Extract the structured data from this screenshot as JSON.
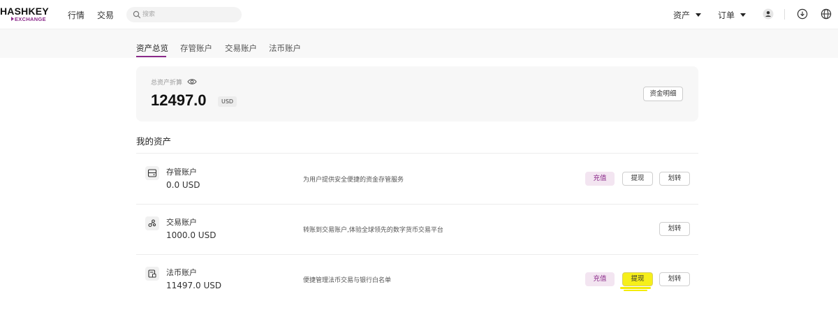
{
  "header": {
    "logo_main": "HASHKEY",
    "logo_sub": "EXCHANGE",
    "nav": [
      "行情",
      "交易"
    ],
    "search_placeholder": "搜索",
    "menus": [
      "资产",
      "订单"
    ]
  },
  "tabs": [
    "资产总览",
    "存管账户",
    "交易账户",
    "法币账户"
  ],
  "summary": {
    "label": "总资产折算",
    "value": "12497.0",
    "unit": "USD",
    "detail_button": "资金明细"
  },
  "section_title": "我的资产",
  "accounts": [
    {
      "icon": "vault-icon",
      "name": "存管账户",
      "balance": "0.0 USD",
      "description": "为用户提供安全便捷的资金存管服务",
      "buttons": {
        "deposit": "充值",
        "withdraw": "提现",
        "transfer": "划转"
      }
    },
    {
      "icon": "nodes-icon",
      "name": "交易账户",
      "balance": "1000.0 USD",
      "description": "转账到交易账户,体验全球领先的数字货币交易平台",
      "buttons": {
        "transfer": "划转"
      }
    },
    {
      "icon": "bank-card-icon",
      "name": "法币账户",
      "balance": "11497.0 USD",
      "description": "便捷管理法币交易与银行白名单",
      "buttons": {
        "deposit": "充值",
        "withdraw": "提现",
        "transfer": "划转"
      }
    }
  ],
  "colors": {
    "accent": "#8b2a8a",
    "deposit_bg": "#f3e5f1",
    "highlight": "#f4ec00"
  }
}
